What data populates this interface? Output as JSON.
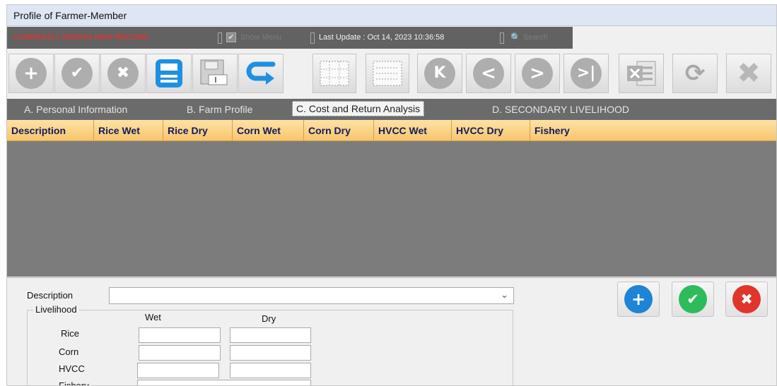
{
  "window": {
    "title": "Profile of Farmer-Member"
  },
  "status": {
    "adding_text": "CURRENTLY ADDING NEW RECORD",
    "show_menu_label": "Show Menu",
    "last_update": "Last Update : Oct 14, 2023 10:36:58",
    "search_label": "Search"
  },
  "toolbar": {
    "add_glyph": "+",
    "confirm_glyph": "✔",
    "cancel_glyph": "✖",
    "first_glyph": "K",
    "prev_glyph": "<",
    "next_glyph": ">",
    "last_glyph": ">|",
    "refresh_glyph": "⟳",
    "close_glyph": "✖"
  },
  "tabs": [
    {
      "label": "A. Personal Information"
    },
    {
      "label": "B. Farm Profile"
    },
    {
      "label": "C. Cost and Return Analysis"
    },
    {
      "label": "D. SECONDARY LIVELIHOOD"
    }
  ],
  "grid": {
    "columns": [
      "Description",
      "Rice Wet",
      "Rice Dry",
      "Corn Wet",
      "Corn Dry",
      "HVCC Wet",
      "HVCC Dry",
      "Fishery"
    ],
    "rows": []
  },
  "form": {
    "description_label": "Description",
    "description_value": "",
    "livelihood_label": "Livelihood",
    "wet_label": "Wet",
    "dry_label": "Dry",
    "rows": [
      {
        "label": "Rice",
        "wet": "",
        "dry": ""
      },
      {
        "label": "Corn",
        "wet": "",
        "dry": ""
      },
      {
        "label": "HVCC",
        "wet": "",
        "dry": ""
      },
      {
        "label": "Fishery",
        "value": ""
      }
    ],
    "add_glyph": "+",
    "ok_glyph": "✔",
    "cancel_glyph": "✖"
  },
  "colors": {
    "status_bar": "#626262",
    "adding_text": "#ff2a1f",
    "grid_header": "#f7c66c",
    "grid_body": "#7c7c7c",
    "save_blue": "#1e90e0",
    "add_blue": "#1d84d6",
    "ok_green": "#2dbb5b",
    "cancel_red": "#e0352b"
  }
}
